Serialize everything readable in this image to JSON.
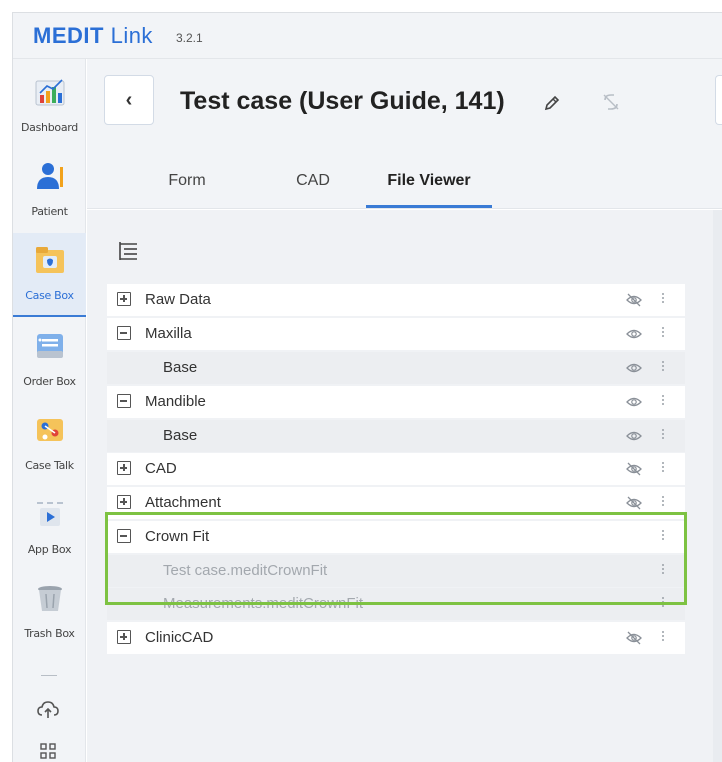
{
  "app": {
    "brand_name": "MEDIT",
    "brand_suffix": "Link",
    "version": "3.2.1",
    "accent_color": "#2b6fd6"
  },
  "sidebar": {
    "items": [
      {
        "label": "Dashboard",
        "icon": "dashboard-icon"
      },
      {
        "label": "Patient",
        "icon": "patient-icon"
      },
      {
        "label": "Case Box",
        "icon": "case-box-icon",
        "active": true
      },
      {
        "label": "Order Box",
        "icon": "order-box-icon"
      },
      {
        "label": "Case Talk",
        "icon": "case-talk-icon"
      },
      {
        "label": "App Box",
        "icon": "app-box-icon"
      },
      {
        "label": "Trash Box",
        "icon": "trash-box-icon"
      }
    ],
    "bottom_icons": [
      "cloud-upload-icon",
      "grid-icon"
    ]
  },
  "header": {
    "back_label": "‹",
    "case_title": "Test case (User Guide, 141)",
    "tabs": [
      {
        "label": "Form"
      },
      {
        "label": "CAD"
      },
      {
        "label": "File Viewer",
        "active": true
      }
    ]
  },
  "tree": {
    "rows": [
      {
        "label": "Raw Data",
        "expander": "plus",
        "eye": "hidden"
      },
      {
        "label": "Maxilla",
        "expander": "minus",
        "eye": "visible"
      },
      {
        "label": "Base",
        "child": true,
        "eye": "visible"
      },
      {
        "label": "Mandible",
        "expander": "minus",
        "eye": "visible"
      },
      {
        "label": "Base",
        "child": true,
        "eye": "visible"
      },
      {
        "label": "CAD",
        "expander": "plus",
        "eye": "hidden"
      },
      {
        "label": "Attachment",
        "expander": "plus",
        "eye": "hidden"
      },
      {
        "label": "Crown Fit",
        "expander": "minus",
        "highlighted": true
      },
      {
        "label": "Test case.meditCrownFit",
        "child": true,
        "disabled": true
      },
      {
        "label": "Measurements.meditCrownFit",
        "child": true,
        "disabled": true
      },
      {
        "label": "ClinicCAD",
        "expander": "plus",
        "eye": "hidden"
      }
    ],
    "highlight_color": "#7dc242"
  }
}
